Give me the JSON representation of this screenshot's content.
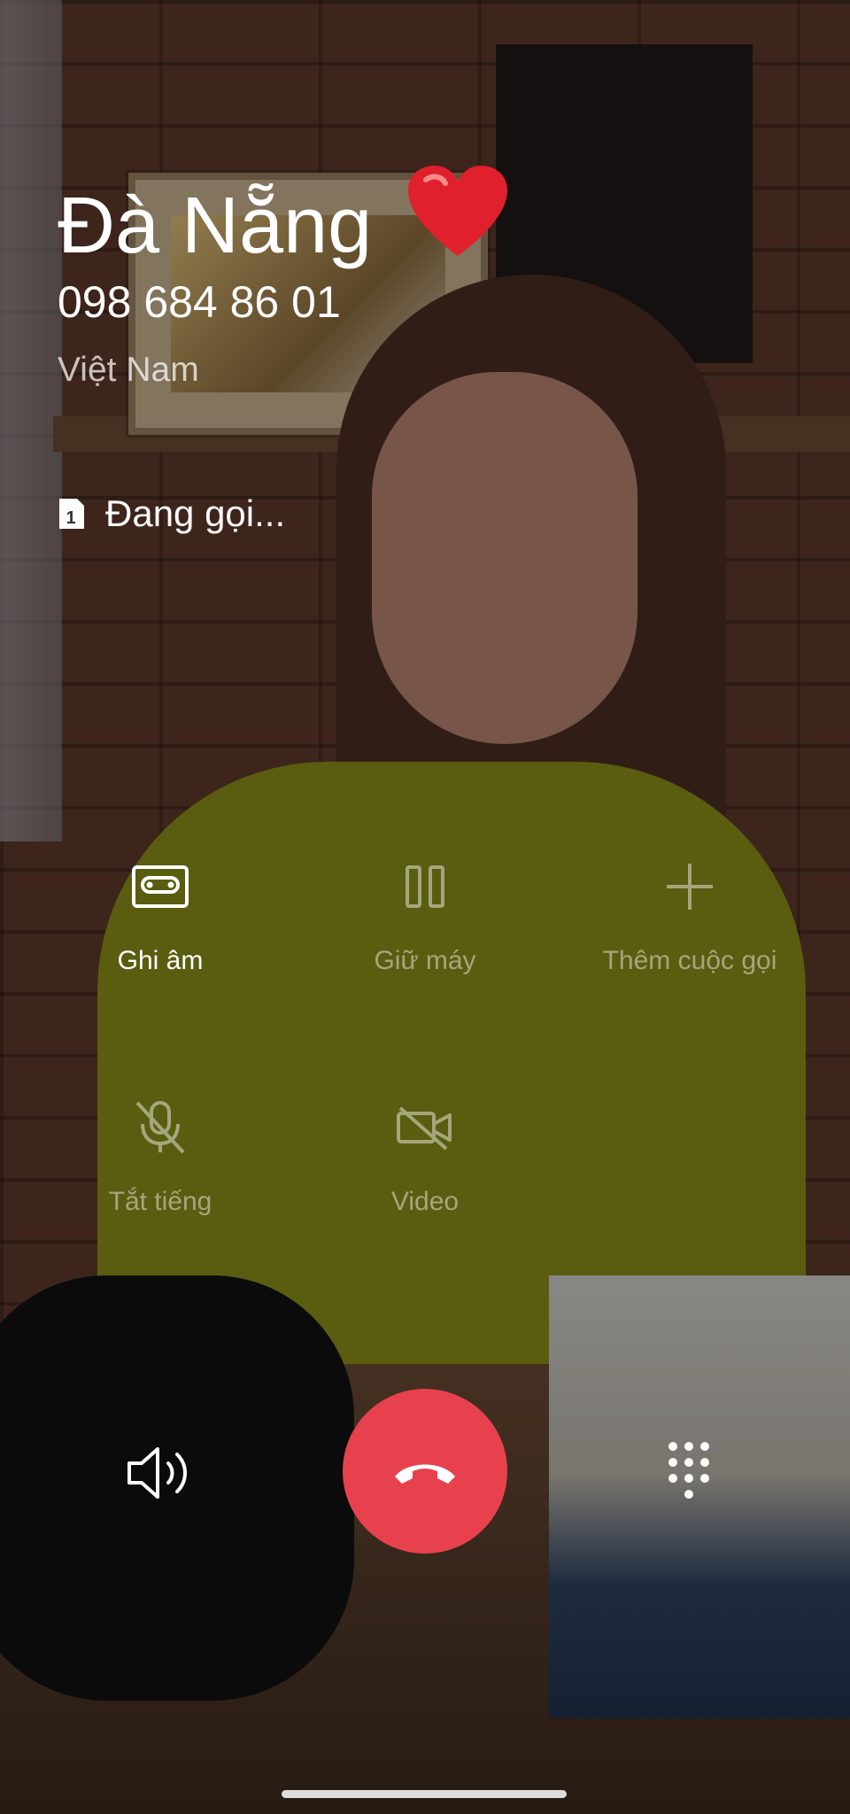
{
  "caller": {
    "name": "Đà Nẵng",
    "number": "098 684 86 01",
    "region": "Việt Nam",
    "status": "Đang gọi...",
    "sim_slot": "1"
  },
  "controls": {
    "record": {
      "label": "Ghi âm",
      "icon": "cassette-icon",
      "enabled": true
    },
    "hold": {
      "label": "Giữ máy",
      "icon": "pause-icon",
      "enabled": false
    },
    "add_call": {
      "label": "Thêm cuộc gọi",
      "icon": "plus-icon",
      "enabled": false
    },
    "mute": {
      "label": "Tắt tiếng",
      "icon": "mic-off-icon",
      "enabled": false
    },
    "video": {
      "label": "Video",
      "icon": "video-camera-icon",
      "enabled": false
    }
  },
  "bottom": {
    "speaker_icon": "speaker-icon",
    "end_call_icon": "end-call-icon",
    "keypad_icon": "keypad-icon"
  },
  "colors": {
    "end_call": "#e8414e",
    "heart": "#e0202c"
  }
}
